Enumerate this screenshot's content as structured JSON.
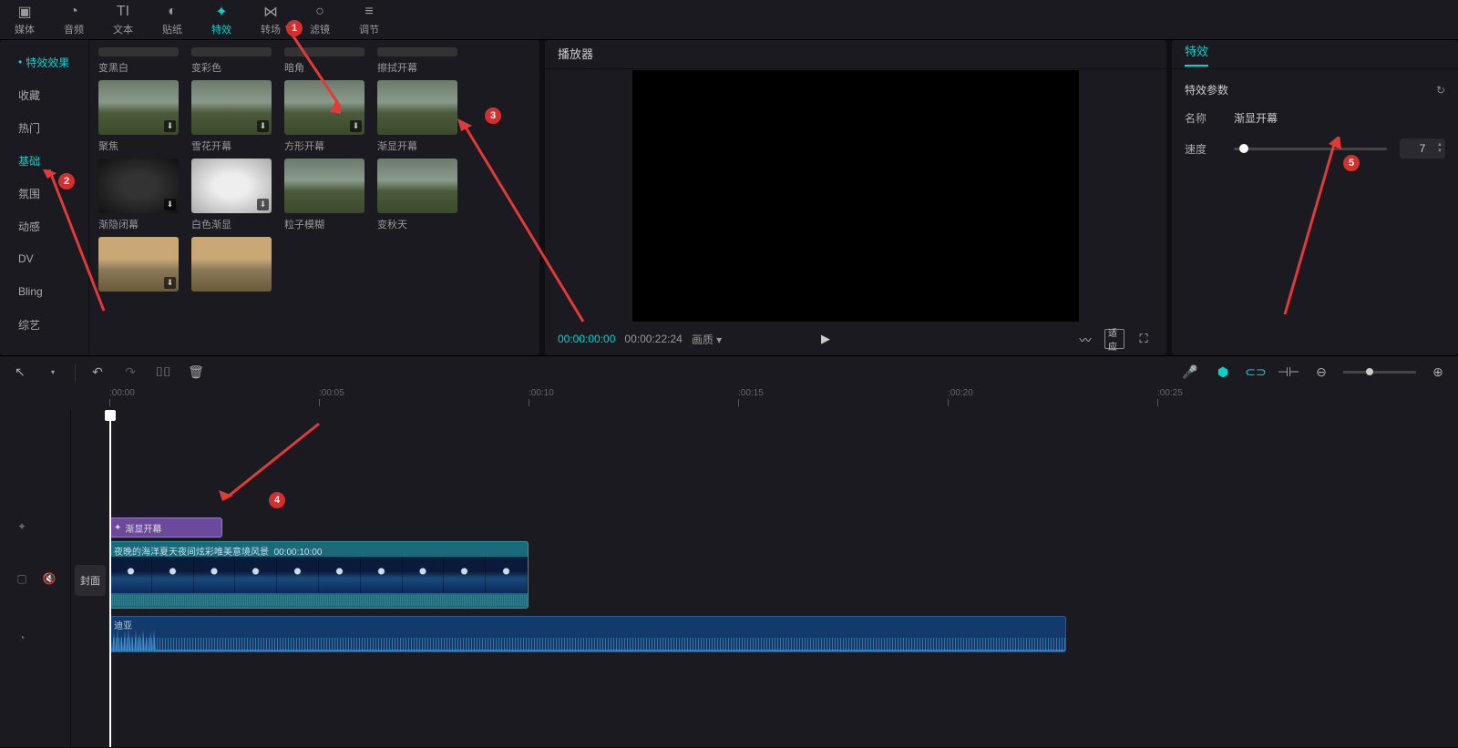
{
  "top_tabs": [
    {
      "icon": "▣",
      "label": "媒体"
    },
    {
      "icon": "◔",
      "label": "音频"
    },
    {
      "icon": "TI",
      "label": "文本"
    },
    {
      "icon": "◐",
      "label": "贴纸"
    },
    {
      "icon": "✦",
      "label": "特效",
      "active": true
    },
    {
      "icon": "⋈",
      "label": "转场"
    },
    {
      "icon": "⊕",
      "label": "滤镜"
    },
    {
      "icon": "⚙",
      "label": "调节"
    }
  ],
  "sidebar": [
    {
      "label": "特效效果",
      "active": true
    },
    {
      "label": "收藏"
    },
    {
      "label": "热门"
    },
    {
      "label": "基础",
      "selected": true
    },
    {
      "label": "氛围"
    },
    {
      "label": "动感"
    },
    {
      "label": "DV"
    },
    {
      "label": "Bling"
    },
    {
      "label": "综艺"
    }
  ],
  "effects": {
    "row0": [
      {
        "label": "变黑白"
      },
      {
        "label": "变彩色"
      },
      {
        "label": "暗角"
      },
      {
        "label": "擦拭开幕"
      }
    ],
    "row1": [
      {
        "label": "聚焦",
        "dl": true
      },
      {
        "label": "雪花开幕",
        "dl": true
      },
      {
        "label": "方形开幕",
        "dl": true
      },
      {
        "label": "渐显开幕"
      }
    ],
    "row2": [
      {
        "label": "渐隐闭幕",
        "dl": true,
        "cls": "dark"
      },
      {
        "label": "白色渐显",
        "dl": true,
        "cls": "white"
      },
      {
        "label": "粒子模糊"
      },
      {
        "label": "变秋天"
      }
    ],
    "row3": [
      {
        "label": "",
        "dl": true,
        "cls": "sand"
      },
      {
        "label": "",
        "cls": "sand"
      }
    ]
  },
  "player": {
    "title": "播放器",
    "time_current": "00:00:00:00",
    "time_duration": "00:00:22:24",
    "quality": "画质"
  },
  "props": {
    "tab": "特效",
    "header": "特效参数",
    "name_label": "名称",
    "name_value": "渐显开幕",
    "speed_label": "速度",
    "speed_value": "7"
  },
  "timeline": {
    "marks": [
      ":00:00",
      ":00:05",
      ":00:10",
      ":00:15",
      ":00:20",
      ":00:25"
    ],
    "cover_btn": "封面",
    "effect_clip": "渐显开幕",
    "video_clip_label": "夜晚的海洋夏天夜间炫彩唯美意境风景",
    "video_clip_time": "00:00:10:00",
    "audio_label": "迪亚"
  },
  "annotations": {
    "b1": "1",
    "b2": "2",
    "b3": "3",
    "b4": "4",
    "b5": "5"
  }
}
